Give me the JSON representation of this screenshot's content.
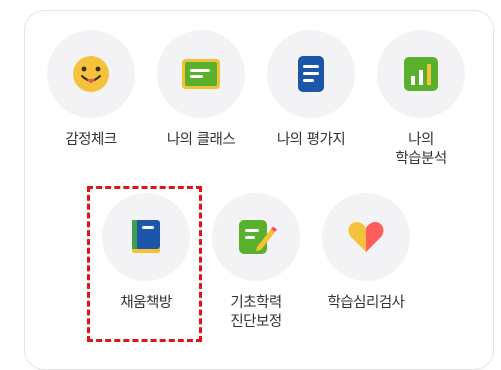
{
  "menu": {
    "items": [
      {
        "id": "emotion-check",
        "label": "감정체크",
        "icon": "smiley-face-icon",
        "color": "#f5c33b"
      },
      {
        "id": "my-class",
        "label": "나의 클래스",
        "icon": "board-icon",
        "color": "#58b02d"
      },
      {
        "id": "my-evaluation",
        "label": "나의 평가지",
        "icon": "document-icon",
        "color": "#1c56a8"
      },
      {
        "id": "my-learning-analysis",
        "label": "나의\n학습분석",
        "icon": "bar-chart-icon",
        "color": "#58b02d"
      },
      {
        "id": "chaeum-bookroom",
        "label": "채움책방",
        "icon": "book-icon",
        "color": "#1c56a8"
      },
      {
        "id": "basic-academic-diagnosis",
        "label": "기초학력\n진단보정",
        "icon": "edit-note-icon",
        "color": "#58b02d"
      },
      {
        "id": "learning-psychology-test",
        "label": "학습심리검사",
        "icon": "heart-icon",
        "color": "#ff5c5c"
      }
    ],
    "highlighted_item": "채움책방",
    "highlight_color": "#e0151b"
  }
}
